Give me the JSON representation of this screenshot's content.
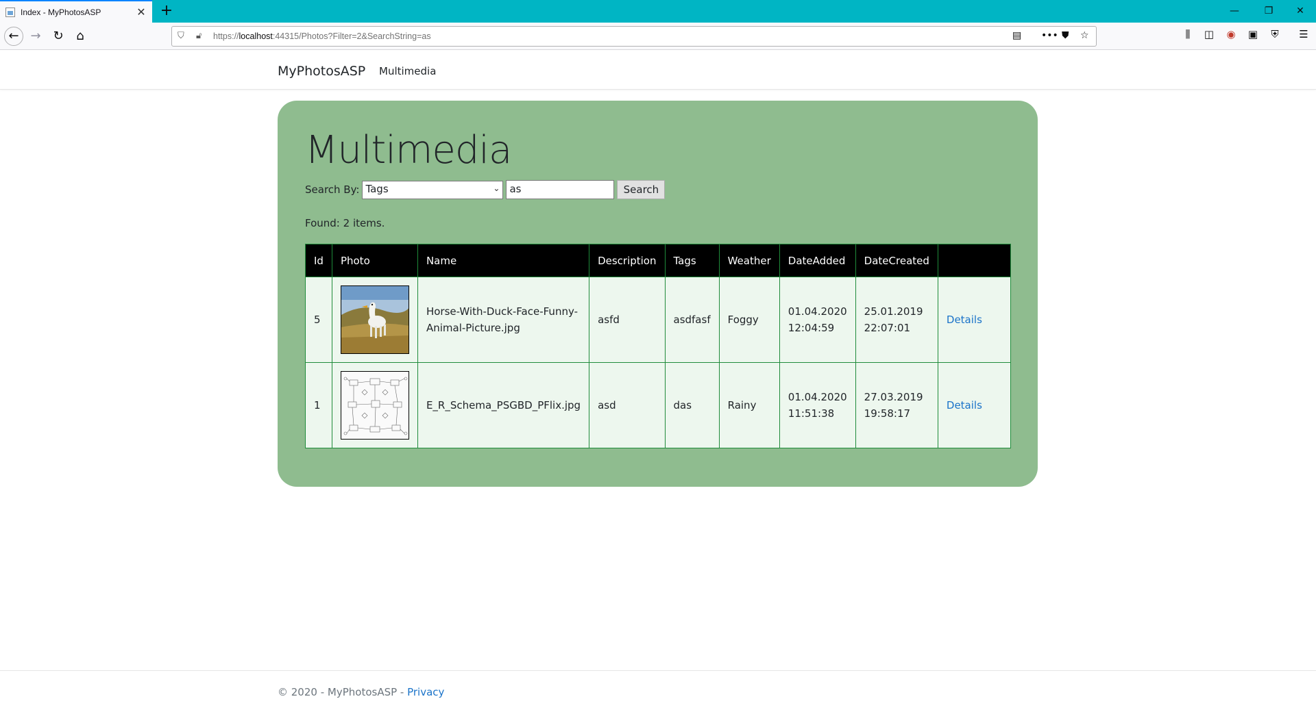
{
  "browser": {
    "tab_title": "Index - MyPhotosASP",
    "url_prefix": "https://",
    "url_host": "localhost",
    "url_rest": ":44315/Photos?Filter=2&SearchString=as"
  },
  "site": {
    "brand": "MyPhotosASP",
    "nav_multimedia": "Multimedia"
  },
  "main": {
    "title": "Multimedia",
    "search_label": "Search By:",
    "search_by_selected": "Tags",
    "search_value": "as",
    "search_button": "Search",
    "found_text": "Found: 2 items."
  },
  "table": {
    "headers": [
      "Id",
      "Photo",
      "Name",
      "Description",
      "Tags",
      "Weather",
      "DateAdded",
      "DateCreated",
      ""
    ],
    "rows": [
      {
        "id": "5",
        "photo_icon": "horse-duck-photo-thumbnail",
        "name": "Horse-With-Duck-Face-Funny-Animal-Picture.jpg",
        "description": "asfd",
        "tags": "asdfasf",
        "weather": "Foggy",
        "date_added_date": "01.04.2020",
        "date_added_time": "12:04:59",
        "date_created_date": "25.01.2019",
        "date_created_time": "22:07:01",
        "details": "Details"
      },
      {
        "id": "1",
        "photo_icon": "er-schema-diagram-thumbnail",
        "name": "E_R_Schema_PSGBD_PFlix.jpg",
        "description": "asd",
        "tags": "das",
        "weather": "Rainy",
        "date_added_date": "01.04.2020",
        "date_added_time": "11:51:38",
        "date_created_date": "27.03.2019",
        "date_created_time": "19:58:17",
        "details": "Details"
      }
    ]
  },
  "footer": {
    "copyright": "© 2020 - MyPhotosASP - ",
    "privacy": "Privacy"
  }
}
